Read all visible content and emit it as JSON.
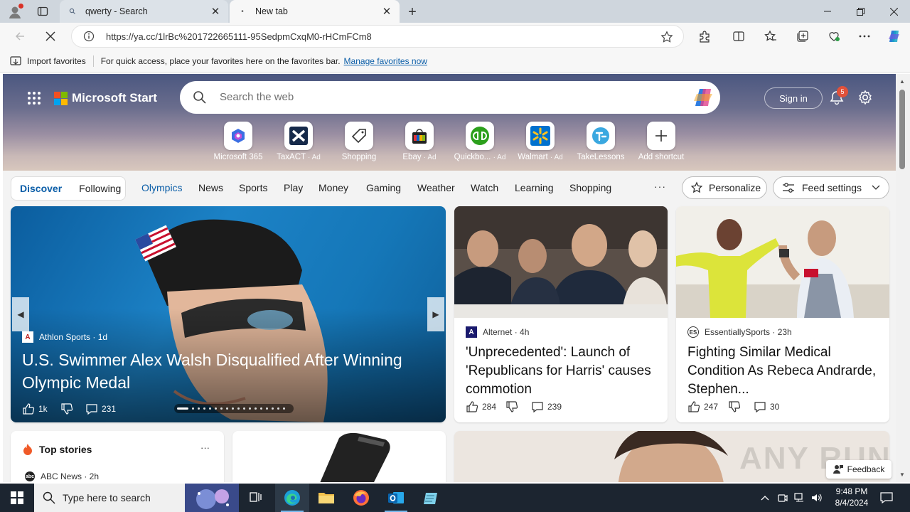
{
  "browser": {
    "tabs": [
      {
        "title": "qwerty - Search",
        "active": false
      },
      {
        "title": "New tab",
        "active": true
      }
    ],
    "url": "https://ya.cc/1lrBc%201722665111-95SedpmCxqM0-rHCmFCm8",
    "favorites_bar": {
      "import_label": "Import favorites",
      "hint": "For quick access, place your favorites here on the favorites bar.",
      "manage_link": "Manage favorites now"
    }
  },
  "header": {
    "brand": "Microsoft Start",
    "search_placeholder": "Search the web",
    "signin": "Sign in",
    "notifications": "5"
  },
  "shortcuts": [
    {
      "label": "Microsoft 365",
      "ad": ""
    },
    {
      "label": "TaxACT",
      "ad": "· Ad"
    },
    {
      "label": "Shopping",
      "ad": ""
    },
    {
      "label": "Ebay",
      "ad": "· Ad"
    },
    {
      "label": "Quickbo...",
      "ad": "· Ad"
    },
    {
      "label": "Walmart",
      "ad": "· Ad"
    },
    {
      "label": "TakeLessons",
      "ad": ""
    },
    {
      "label": "Add shortcut",
      "ad": ""
    }
  ],
  "feed_nav": {
    "discover": "Discover",
    "following": "Following",
    "links": [
      "Olympics",
      "News",
      "Sports",
      "Play",
      "Money",
      "Gaming",
      "Weather",
      "Watch",
      "Learning",
      "Shopping"
    ],
    "more": "···",
    "personalize": "Personalize",
    "feed_settings": "Feed settings"
  },
  "cards": {
    "hero": {
      "source": "Athlon Sports · 1d",
      "title": "U.S. Swimmer Alex Walsh Disqualified After Winning Olympic Medal",
      "likes": "1k",
      "comments": "231"
    },
    "card2": {
      "source": "Alternet · 4h",
      "title": "'Unprecedented': Launch of 'Republicans for Harris' causes commotion",
      "likes": "284",
      "comments": "239"
    },
    "card3": {
      "source": "EssentiallySports · 23h",
      "title": "Fighting Similar Medical Condition As Rebeca Andrarde, Stephen...",
      "likes": "247",
      "comments": "30"
    },
    "top_stories": {
      "title": "Top stories",
      "more": "···",
      "source": "ABC News · 2h"
    }
  },
  "feedback": "Feedback",
  "watermark": "ANY RUN",
  "taskbar": {
    "search_placeholder": "Type here to search",
    "time": "9:48 PM",
    "date": "8/4/2024"
  },
  "colors": {
    "accent": "#0b5ea8",
    "taskbar": "#1c2530"
  }
}
